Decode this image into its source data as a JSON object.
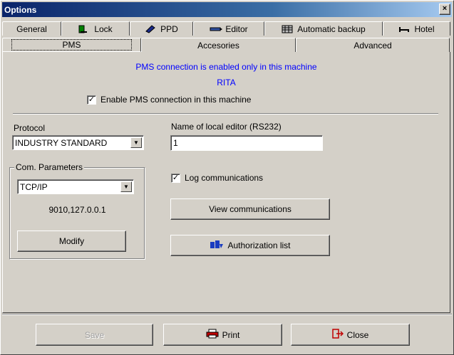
{
  "window": {
    "title": "Options",
    "close_glyph": "×"
  },
  "tabs_row1": [
    {
      "label": "General",
      "icon": null
    },
    {
      "label": "Lock",
      "icon": "lock-icon"
    },
    {
      "label": "PPD",
      "icon": "ppd-icon"
    },
    {
      "label": "Editor",
      "icon": "editor-icon"
    },
    {
      "label": "Automatic backup",
      "icon": "backup-icon"
    },
    {
      "label": "Hotel",
      "icon": "bed-icon"
    }
  ],
  "tabs_row2": [
    {
      "label": "PMS",
      "active": true
    },
    {
      "label": "Accesories",
      "active": false
    },
    {
      "label": "Advanced",
      "active": false
    }
  ],
  "pms": {
    "info_line1": "PMS connection is enabled only in this machine",
    "info_line2": "RITA",
    "enable_label": "Enable PMS connection in this machine",
    "enable_checked": true,
    "protocol_label": "Protocol",
    "protocol_value": "INDUSTRY STANDARD",
    "local_editor_label": "Name of local editor (RS232)",
    "local_editor_value": "1",
    "com_group_title": "Com. Parameters",
    "com_value": "TCP/IP",
    "com_address": "9010,127.0.0.1",
    "modify_label": "Modify",
    "log_label": "Log communications",
    "log_checked": true,
    "view_comm_label": "View communications",
    "auth_list_label": "Authorization list"
  },
  "footer": {
    "save_label": "Save",
    "print_label": "Print",
    "close_label": "Close"
  },
  "colors": {
    "info_text": "#0000ff",
    "title_bar": "#0a246a",
    "face": "#d4d0c8"
  }
}
